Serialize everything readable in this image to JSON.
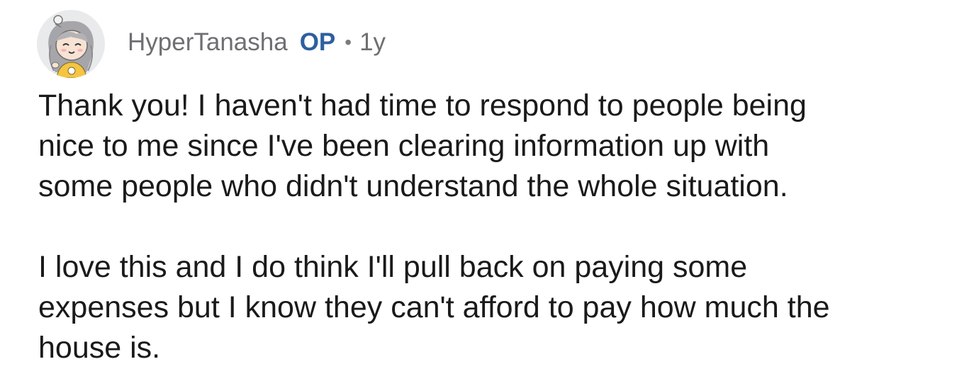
{
  "comment": {
    "author": {
      "username": "HyperTanasha",
      "badge": "OP",
      "avatar_icon": "avatar-icon"
    },
    "separator": "•",
    "age": "1y",
    "paragraphs": [
      "Thank you!  I haven't had time to respond to people being\nnice to me since I've been clearing information up with\nsome people who didn't understand the whole situation.",
      "I love this and I do think I'll pull back on paying some\nexpenses but I know they can't afford to pay how much the\nhouse is."
    ]
  },
  "colors": {
    "background": "#ffffff",
    "username": "#6f6f72",
    "op_badge": "#2e5f9e",
    "body_text": "#1a1a1b",
    "avatar_bg": "#e9eaec"
  }
}
